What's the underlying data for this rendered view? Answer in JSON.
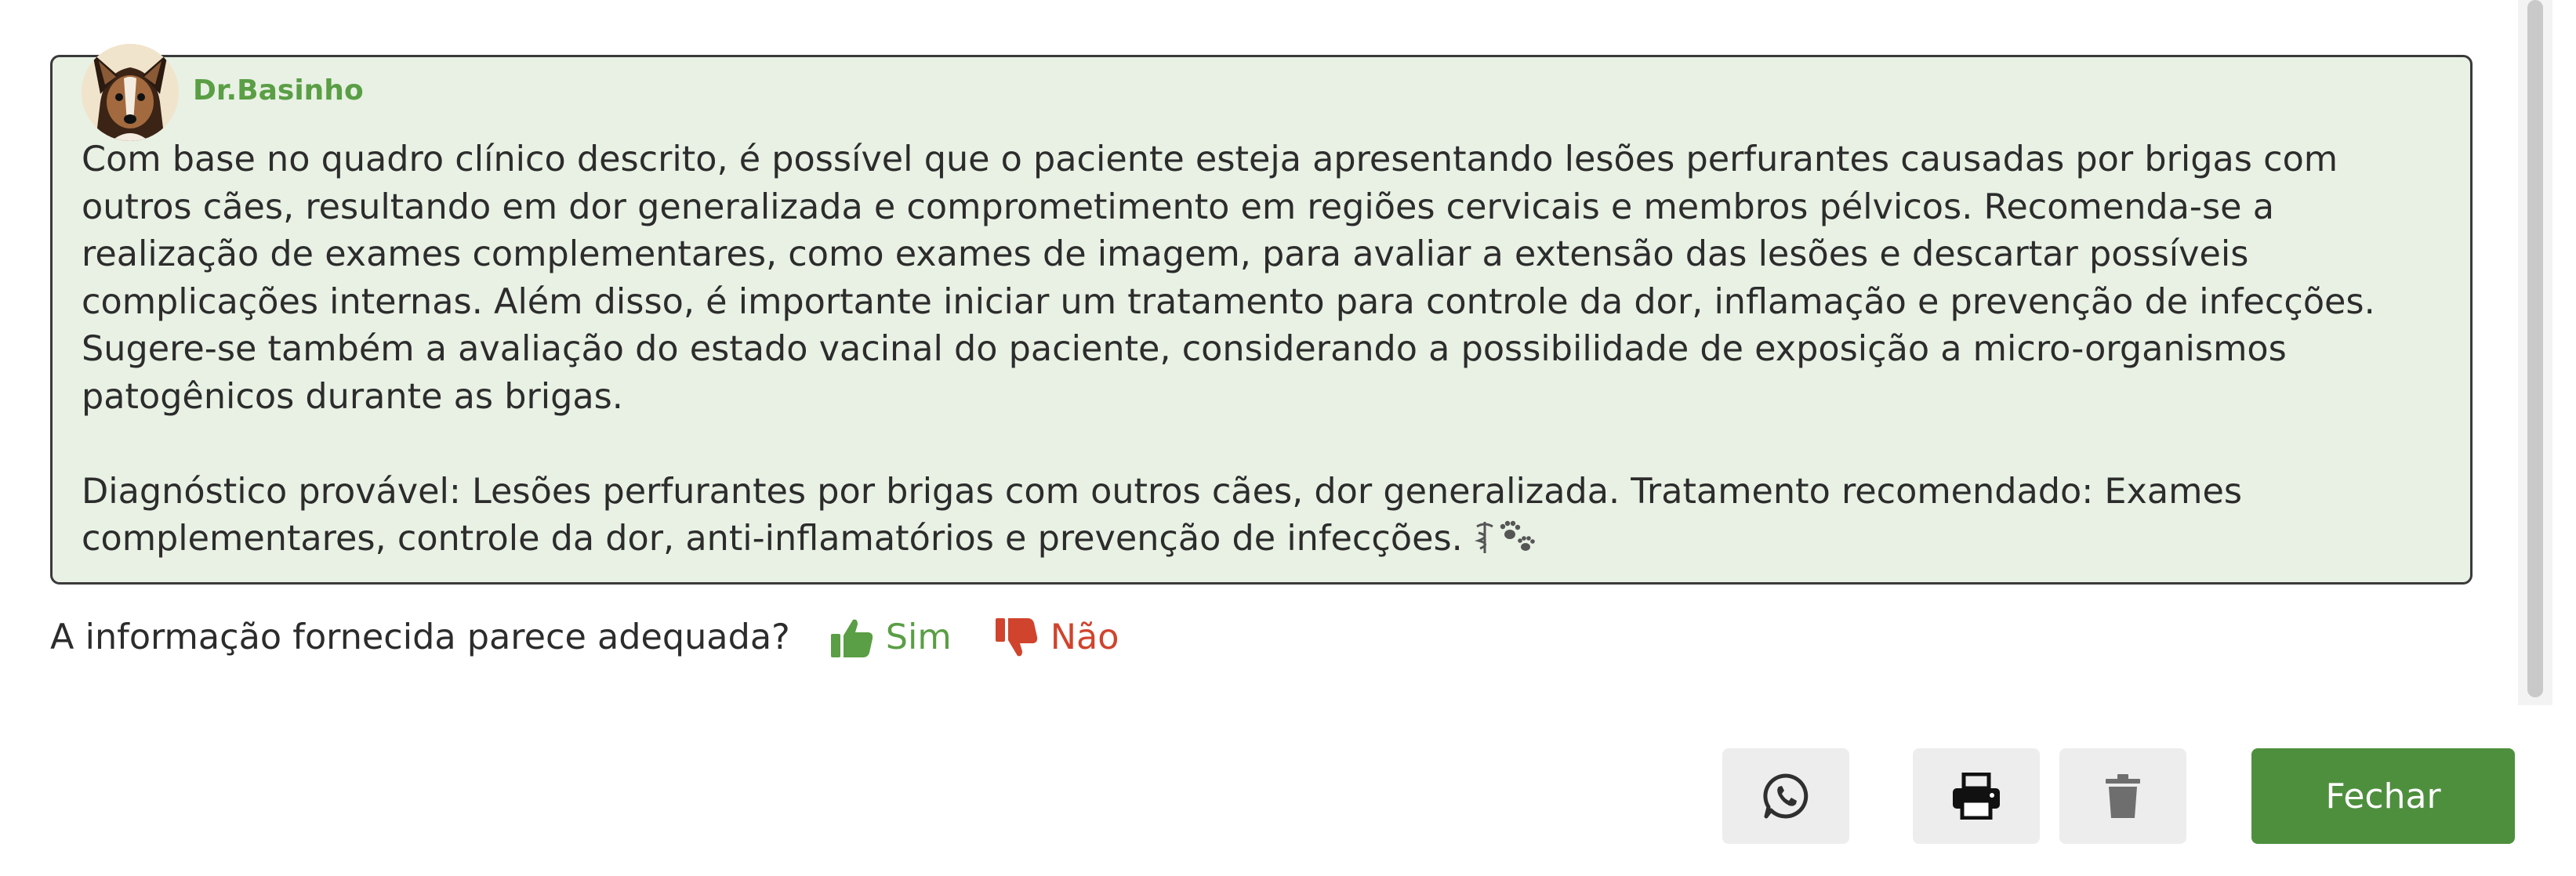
{
  "chat": {
    "bot_name": "Dr.Basinho",
    "avatar_icon": "dog-avatar-icon",
    "paragraph_1": "Com base no quadro clínico descrito, é possível que o paciente esteja apresentando lesões perfurantes causadas por brigas com outros cães, resultando em dor generalizada e comprometimento em regiões cervicais e membros pélvicos. Recomenda-se a realização de exames complementares, como exames de imagem, para avaliar a extensão das lesões e descartar possíveis complicações internas. Além disso, é importante iniciar um tratamento para controle da dor, inflamação e prevenção de infecções. Sugere-se também a avaliação do estado vacinal do paciente, considerando a possibilidade de exposição a micro-organismos patogênicos durante as brigas.",
    "paragraph_2": "Diagnóstico provável: Lesões perfurantes por brigas com outros cães, dor generalizada. Tratamento recomendado: Exames complementares, controle da dor, anti-inflamatórios e prevenção de infecções.",
    "trailing_icons": [
      "medical-caduceus-icon",
      "paw-prints-icon"
    ]
  },
  "feedback": {
    "question": "A informação fornecida parece adequada?",
    "yes_label": "Sim",
    "no_label": "Não"
  },
  "actions": {
    "whatsapp_icon": "whatsapp-icon",
    "print_icon": "printer-icon",
    "delete_icon": "trash-icon",
    "close_label": "Fechar"
  },
  "colors": {
    "card_background": "#e8f1e4",
    "accent_green": "#5a9e45",
    "close_button": "#4e8f3e",
    "negative_red": "#d0442d"
  }
}
